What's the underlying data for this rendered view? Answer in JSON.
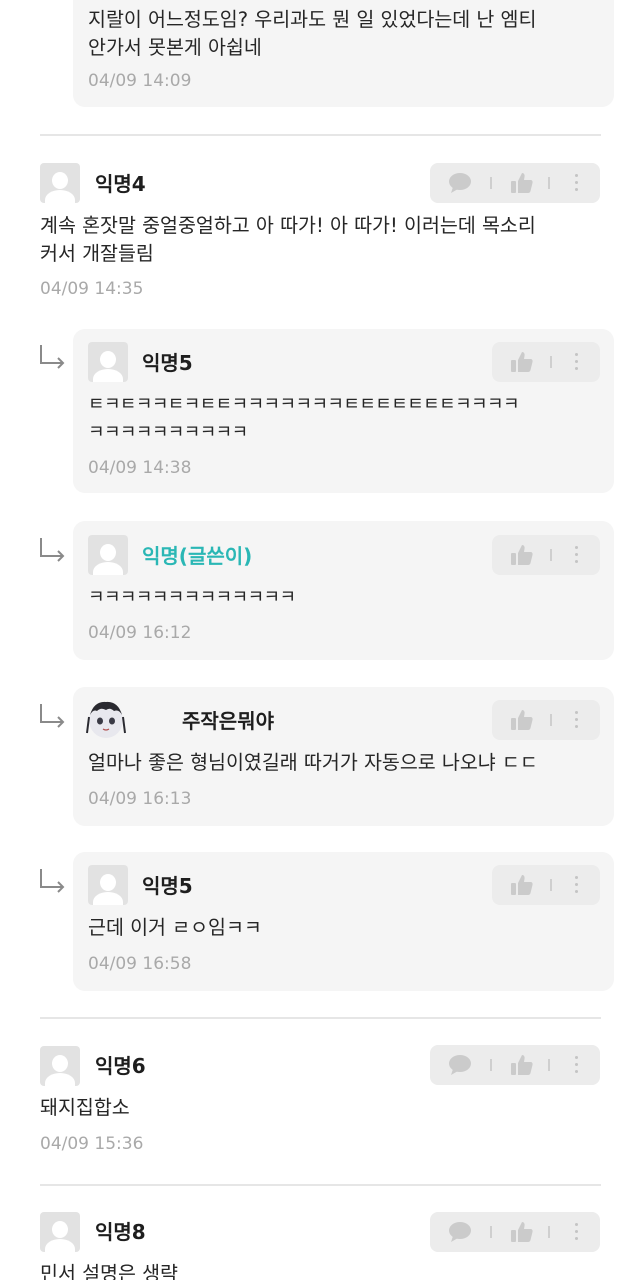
{
  "comments": [
    {
      "id": "c0",
      "kind": "reply",
      "author": "",
      "text_lines": [
        "지랄이 어느정도임? 우리과도 뭔 일 있었다는데 난 엠티",
        "안가서 못본게 아쉽네"
      ],
      "time": "04/09 14:09"
    },
    {
      "id": "c1",
      "kind": "comment",
      "author": "익명4",
      "text_lines": [
        "계속 혼잣말 중얼중얼하고 아 따가! 아 따가! 이러는데 목소리",
        "커서 개잘들림"
      ],
      "time": "04/09 14:35"
    },
    {
      "id": "c2",
      "kind": "reply",
      "author": "익명5",
      "text_lines": [
        "ㅌㅋㅌㅋㅋㅌㅋㅌㅌㅋㅋㅋㅋㅋㅋㅋㅌㅌㅌㅌㅌㅌㅌㅋㅋㅋㅋ",
        "ㅋㅋㅋㅋㅋㅋㅋㅋㅋㅋ"
      ],
      "time": "04/09 14:38"
    },
    {
      "id": "c3",
      "kind": "reply",
      "author": "익명(글쓴이)",
      "author_is_op": true,
      "text_lines": [
        "ㅋㅋㅋㅋㅋㅋㅋㅋㅋㅋㅋㅋㅋ"
      ],
      "time": "04/09 16:12"
    },
    {
      "id": "c4",
      "kind": "reply",
      "author": "주작은뭐야",
      "text_lines": [
        "얼마나 좋은 형님이였길래 따거가 자동으로 나오냐 ㄷㄷ"
      ],
      "time": "04/09 16:13"
    },
    {
      "id": "c5",
      "kind": "reply",
      "author": "익명5",
      "text_lines": [
        "근데 이거 ㄹㅇ임ㅋㅋ"
      ],
      "time": "04/09 16:58"
    },
    {
      "id": "c6",
      "kind": "comment",
      "author": "익명6",
      "text_lines": [
        "돼지집합소"
      ],
      "time": "04/09 15:36"
    },
    {
      "id": "c7",
      "kind": "comment",
      "author": "익명8",
      "text_lines": [
        "민서 설명은 생략"
      ],
      "time": ""
    }
  ],
  "icons": {
    "reply": "reply-icon",
    "like": "thumbs-up-icon",
    "more": "more-vertical-icon",
    "comment": "speech-bubble-icon",
    "avatar": "default-avatar-icon"
  },
  "colors": {
    "author_highlight": "#2ab7b5",
    "bubble_bg": "#f5f5f5",
    "timestamp": "#a9a9a9"
  }
}
